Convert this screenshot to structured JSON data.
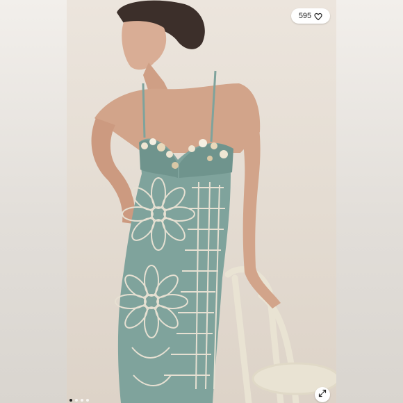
{
  "listing": {
    "like_count": "595",
    "like_icon": "heart-outline-icon",
    "expand_icon": "expand-arrows-icon",
    "gallery_dots": [
      {
        "active": true
      },
      {
        "active": false
      },
      {
        "active": false
      },
      {
        "active": false
      }
    ]
  },
  "colors": {
    "dress": "#7fa39c",
    "backdrop": "#e6ddd3",
    "chair": "#e9e3d3",
    "skin": "#c99a80"
  }
}
